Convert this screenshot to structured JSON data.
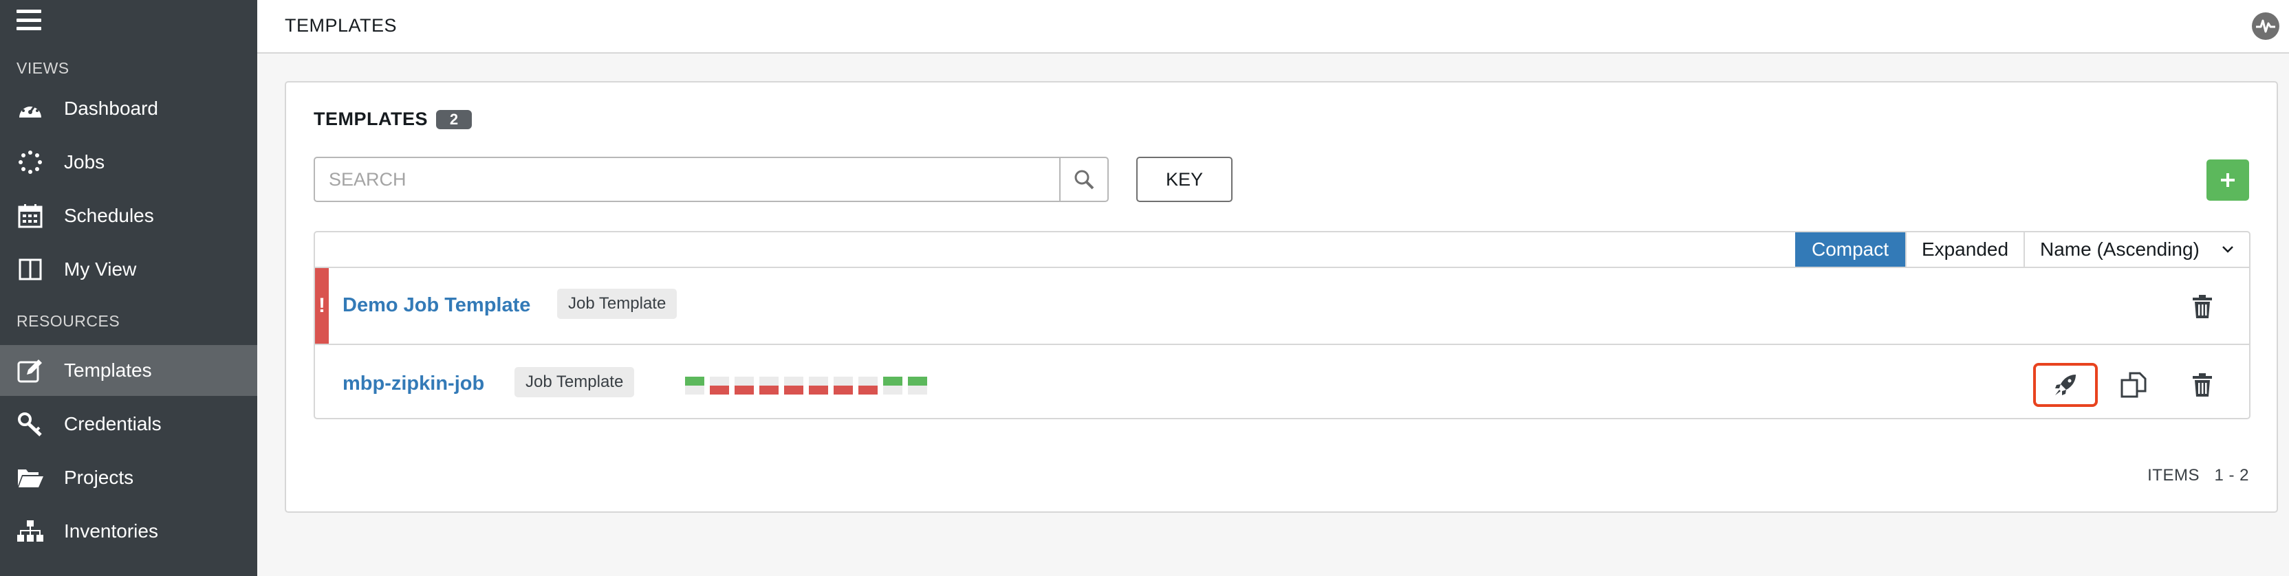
{
  "sidebar": {
    "views_label": "VIEWS",
    "resources_label": "RESOURCES",
    "views": [
      {
        "label": "Dashboard",
        "icon": "dashboard-icon"
      },
      {
        "label": "Jobs",
        "icon": "jobs-spinner-icon"
      },
      {
        "label": "Schedules",
        "icon": "calendar-icon"
      },
      {
        "label": "My View",
        "icon": "columns-icon"
      }
    ],
    "resources": [
      {
        "label": "Templates",
        "icon": "edit-icon",
        "active": true
      },
      {
        "label": "Credentials",
        "icon": "key-icon"
      },
      {
        "label": "Projects",
        "icon": "folder-icon"
      },
      {
        "label": "Inventories",
        "icon": "sitemap-icon"
      }
    ]
  },
  "header": {
    "breadcrumb": "TEMPLATES",
    "activity_icon": "activity-stream-icon"
  },
  "panel": {
    "title": "TEMPLATES",
    "count": "2",
    "search_placeholder": "SEARCH",
    "key_label": "KEY",
    "add_icon": "plus-icon"
  },
  "list": {
    "view_compact": "Compact",
    "view_expanded": "Expanded",
    "sort_label": "Name (Ascending)",
    "rows": [
      {
        "name": "Demo Job Template",
        "type": "Job Template",
        "alert": true
      },
      {
        "name": "mbp-zipkin-job",
        "type": "Job Template",
        "alert": false,
        "job_statuses": [
          "successful",
          "failed",
          "failed",
          "failed",
          "failed",
          "failed",
          "failed",
          "failed",
          "successful",
          "successful"
        ]
      }
    ],
    "footer_label": "ITEMS",
    "footer_range": "1 - 2"
  },
  "colors": {
    "sidebar_bg": "#393f44",
    "active_item_bg": "#5f6468",
    "link_blue": "#337ab7",
    "success_green": "#5cb85c",
    "danger_red": "#d9534f",
    "highlight_orange": "#e8431f"
  }
}
